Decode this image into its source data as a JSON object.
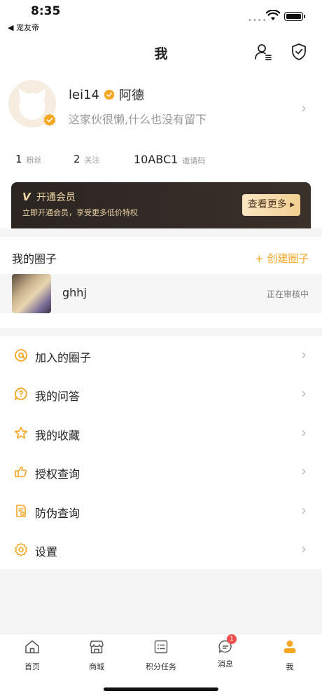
{
  "status_bar": {
    "time": "8:35",
    "back_label": "◀ 宠友帝"
  },
  "nav": {
    "title": "我"
  },
  "profile": {
    "username": "lei14",
    "nickname": "阿德",
    "bio": "这家伙很懒,什么也没有留下",
    "stats": [
      {
        "value": "1",
        "label": "粉丝"
      },
      {
        "value": "2",
        "label": "关注"
      },
      {
        "value": "10ABC1",
        "label": "邀请码"
      }
    ]
  },
  "vip": {
    "logo": "V",
    "title": "开通会员",
    "subtitle": "立即开通会员，享受更多低价特权",
    "button": "查看更多 ▸"
  },
  "circles": {
    "heading": "我的圈子",
    "create_label": "+ 创建圈子",
    "items": [
      {
        "name": "ghhj",
        "status": "正在审核中"
      }
    ]
  },
  "menu": [
    {
      "label": "加入的圈子",
      "icon": "joined-circle-icon"
    },
    {
      "label": "我的问答",
      "icon": "qa-icon"
    },
    {
      "label": "我的收藏",
      "icon": "star-icon"
    },
    {
      "label": "授权查询",
      "icon": "authorize-icon"
    },
    {
      "label": "防伪查询",
      "icon": "anti-fake-icon"
    },
    {
      "label": "设置",
      "icon": "settings-icon"
    }
  ],
  "tabbar": [
    {
      "label": "首页",
      "icon": "home-icon"
    },
    {
      "label": "商城",
      "icon": "store-icon"
    },
    {
      "label": "积分任务",
      "icon": "task-icon"
    },
    {
      "label": "消息",
      "icon": "message-icon",
      "badge": "1"
    },
    {
      "label": "我",
      "icon": "me-icon",
      "active": true
    }
  ],
  "colors": {
    "accent": "#f5a623",
    "vip_dark": "#2b2522",
    "vip_gold": "#f3d9a8",
    "badge_red": "#f0504d"
  }
}
